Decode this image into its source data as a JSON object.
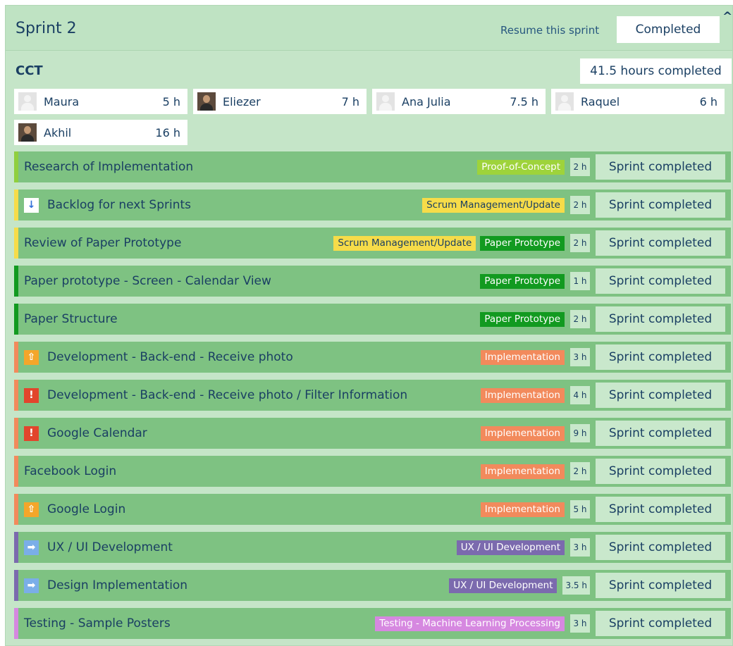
{
  "sprint": {
    "title": "Sprint 2",
    "resume_label": "Resume this sprint",
    "state_button": "Completed",
    "collapse_glyph": "^"
  },
  "project": {
    "name": "CCT",
    "hours_completed": "41.5 hours completed"
  },
  "members": [
    {
      "name": "Maura",
      "hours": "5 h",
      "avatar": "placeholder-avatar"
    },
    {
      "name": "Eliezer",
      "hours": "7 h",
      "avatar": "photo-avatar"
    },
    {
      "name": "Ana Julia",
      "hours": "7.5 h",
      "avatar": "placeholder-avatar"
    },
    {
      "name": "Raquel",
      "hours": "6 h",
      "avatar": "placeholder-avatar"
    },
    {
      "name": "Akhil",
      "hours": "16 h",
      "avatar": "photo-avatar"
    }
  ],
  "tag_colors": {
    "Proof-of-Concept": "#9ed33b",
    "Scrum Management/Update": "#f6dc49",
    "Paper Prototype": "#129a20",
    "Implementation": "#f28a5c",
    "UX / UI Development": "#7b6aae",
    "Testing - Machine Learning Processing": "#d688e0"
  },
  "tag_text_colors": {
    "Scrum Management/Update": "#1a3f63"
  },
  "priority_icons": {
    "low": {
      "name": "arrow-down-icon",
      "glyph": "↓",
      "color": "#2f6fd8"
    },
    "high": {
      "name": "arrow-up-icon",
      "glyph": "⇧",
      "color": "#f4a62a"
    },
    "urgent": {
      "name": "exclamation-icon",
      "glyph": "!",
      "color": "#e2452c"
    },
    "normal": {
      "name": "arrow-right-icon",
      "glyph": "➡",
      "color": "#7aaee8"
    }
  },
  "tasks": [
    {
      "title": "Research of Implementation",
      "color": "#8fcf3e",
      "icon": null,
      "tags": [
        "Proof-of-Concept"
      ],
      "hours": "2 h",
      "status": "Sprint completed"
    },
    {
      "title": "Backlog for next Sprints",
      "color": "#f6dc49",
      "icon": "low",
      "tags": [
        "Scrum Management/Update"
      ],
      "hours": "2 h",
      "status": "Sprint completed"
    },
    {
      "title": "Review of Paper Prototype",
      "color": "#f6dc49",
      "icon": null,
      "tags": [
        "Scrum Management/Update",
        "Paper Prototype"
      ],
      "hours": "2 h",
      "status": "Sprint completed"
    },
    {
      "title": "Paper prototype - Screen - Calendar View",
      "color": "#129a20",
      "icon": null,
      "tags": [
        "Paper Prototype"
      ],
      "hours": "1 h",
      "status": "Sprint completed"
    },
    {
      "title": "Paper Structure",
      "color": "#129a20",
      "icon": null,
      "tags": [
        "Paper Prototype"
      ],
      "hours": "2 h",
      "status": "Sprint completed"
    },
    {
      "title": "Development - Back-end - Receive photo",
      "color": "#f28a5c",
      "icon": "high",
      "tags": [
        "Implementation"
      ],
      "hours": "3 h",
      "status": "Sprint completed"
    },
    {
      "title": "Development - Back-end - Receive photo / Filter Information",
      "color": "#f28a5c",
      "icon": "urgent",
      "tags": [
        "Implementation"
      ],
      "hours": "4 h",
      "status": "Sprint completed"
    },
    {
      "title": "Google Calendar",
      "color": "#f28a5c",
      "icon": "urgent",
      "tags": [
        "Implementation"
      ],
      "hours": "9 h",
      "status": "Sprint completed"
    },
    {
      "title": "Facebook Login",
      "color": "#f28a5c",
      "icon": null,
      "tags": [
        "Implementation"
      ],
      "hours": "2 h",
      "status": "Sprint completed"
    },
    {
      "title": "Google Login",
      "color": "#f28a5c",
      "icon": "high",
      "tags": [
        "Implementation"
      ],
      "hours": "5 h",
      "status": "Sprint completed"
    },
    {
      "title": "UX / UI Development",
      "color": "#7b6aae",
      "icon": "normal",
      "tags": [
        "UX / UI Development"
      ],
      "hours": "3 h",
      "status": "Sprint completed"
    },
    {
      "title": "Design Implementation",
      "color": "#7b6aae",
      "icon": "normal",
      "tags": [
        "UX / UI Development"
      ],
      "hours": "3.5 h",
      "status": "Sprint completed"
    },
    {
      "title": "Testing - Sample Posters",
      "color": "#d688e0",
      "icon": null,
      "tags": [
        "Testing - Machine Learning Processing"
      ],
      "hours": "3 h",
      "status": "Sprint completed"
    }
  ]
}
